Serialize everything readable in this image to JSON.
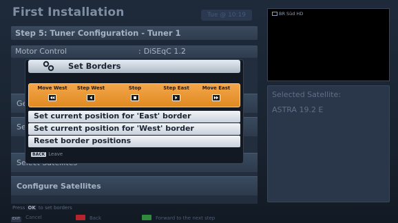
{
  "window": {
    "title": "First Installation",
    "clock": "Tue @ 10:19"
  },
  "step": {
    "title": "Step 5: Tuner Configuration - Tuner 1"
  },
  "motor_control": {
    "label": "Motor Control",
    "separator": ":",
    "value": "DiSEqC 1.2"
  },
  "menu": {
    "row_ge": "Ge",
    "row_se": "Se",
    "select_satellites": "Select Satellites",
    "configure_satellites": "Configure Satellites"
  },
  "preview": {
    "channel": "BR Süd HD"
  },
  "satellite_panel": {
    "header": "Selected Satellite:",
    "value": "ASTRA 19.2 E"
  },
  "dialog": {
    "title": "Set Borders",
    "controls": [
      {
        "label": "Move West",
        "icon": "fast-rewind-icon"
      },
      {
        "label": "Step West",
        "icon": "step-left-icon"
      },
      {
        "label": "Stop",
        "icon": "stop-icon"
      },
      {
        "label": "Step East",
        "icon": "step-right-icon"
      },
      {
        "label": "Move East",
        "icon": "fast-forward-icon"
      }
    ],
    "options": [
      "Set current position for 'East' border",
      "Set current position for 'West' border",
      "Reset border positions"
    ],
    "leave_key": "BACK",
    "leave_label": "Leave"
  },
  "hint": {
    "prefix": "Press",
    "key": "OK",
    "suffix": "to set borders"
  },
  "footer": {
    "cancel_key": "EXIT",
    "cancel": "Cancel",
    "back": "Back",
    "forward": "Forward to the next step",
    "colors": {
      "red": "#b3242c",
      "green": "#2f8a3c"
    }
  },
  "colors": {
    "accent_orange": "#f0a040",
    "background": "#1a2431"
  }
}
